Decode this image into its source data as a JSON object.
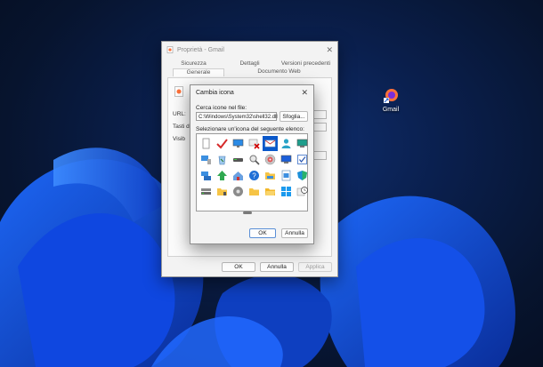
{
  "desktop": {
    "shortcut_label": "Gmail"
  },
  "properties": {
    "title": "Proprietà - Gmail",
    "tabs_row1": [
      "Sicurezza",
      "Dettagli",
      "Versioni precedenti"
    ],
    "tabs_row2": [
      "Generale",
      "Documento Web"
    ],
    "labels": {
      "url": "URL:",
      "keys": "Tasti di",
      "view": "Visib"
    },
    "buttons": {
      "ok": "OK",
      "cancel": "Annulla",
      "apply": "Applica"
    }
  },
  "change_icon": {
    "title": "Cambia icona",
    "file_label": "Cerca icone nel file:",
    "file_value": "C:\\Windows\\System32\\shell32.dll",
    "browse": "Sfoglia...",
    "list_label": "Selezionare un'icona del seguente elenco:",
    "icons": [
      "blank-doc-icon",
      "check-mark-icon",
      "monitor-icon",
      "delete-x-icon",
      "envelope-icon",
      "users-icon",
      "green-monitor-icon",
      "computer-icon",
      "recycle-icon",
      "drive-icon",
      "search-icon",
      "disc-icon",
      "monitor-blue-icon",
      "checkbox-icon",
      "shares-icon",
      "up-arrow-icon",
      "house-icon",
      "help-icon",
      "folder-icon",
      "document-icon",
      "shield-icon",
      "drive-stack-icon",
      "folder-lock-icon",
      "disc-gray-icon",
      "folder-plain-icon",
      "folder-open-icon",
      "windows-icon",
      "clock-icon"
    ],
    "selected_index": 4,
    "buttons": {
      "ok": "OK",
      "cancel": "Annulla"
    }
  }
}
